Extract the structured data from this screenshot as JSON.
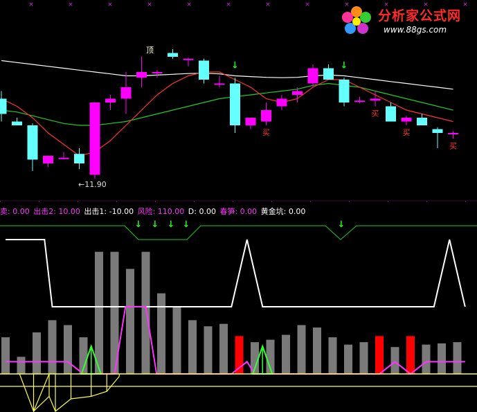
{
  "logo": {
    "title": "分析家公式网",
    "url": "www.88gs.com"
  },
  "colors": {
    "background": "#000000",
    "candle_up": "#ff00ff",
    "candle_down": "#66ffff",
    "ma_short": "#ff3333",
    "ma_mid": "#ffffff",
    "ma_long": "#22cc22",
    "arrow": "#22ee22",
    "buy_label": "#ff3333",
    "bar_gray": "#7a7a7a",
    "bar_red": "#ff0000",
    "white_line": "#ffffff",
    "magenta_line": "#ff33ff",
    "green_line": "#33ff33",
    "yellow_line": "#ffff44",
    "star_marker": "#cc33cc"
  },
  "indicator_labels": [
    {
      "text": "卖: 0.00",
      "color": "#ff33ff"
    },
    {
      "text": "出击2: 10.00",
      "color": "#ff33ff"
    },
    {
      "text": "出击1: -10.00",
      "color": "#ffffff"
    },
    {
      "text": "风险: 110.00",
      "color": "#ff33ff"
    },
    {
      "text": "D: 0.00",
      "color": "#ffffff"
    },
    {
      "text": "春笋: 0.00",
      "color": "#ff33ff"
    },
    {
      "text": "黄金坑: 0.00",
      "color": "#ffffff"
    }
  ],
  "annotations": {
    "top_label": "顶",
    "low_label": "←11.90",
    "buy_label": "买"
  },
  "chart_data": [
    {
      "type": "candlestick",
      "title": "",
      "ylim": [
        11.5,
        15.5
      ],
      "candles": [
        {
          "o": 14.0,
          "h": 14.2,
          "l": 13.4,
          "c": 13.6
        },
        {
          "o": 13.4,
          "h": 13.5,
          "l": 13.3,
          "c": 13.3
        },
        {
          "o": 13.3,
          "h": 13.35,
          "l": 12.1,
          "c": 12.4
        },
        {
          "o": 12.3,
          "h": 12.5,
          "l": 12.2,
          "c": 12.5
        },
        {
          "o": 12.45,
          "h": 12.6,
          "l": 12.4,
          "c": 12.45
        },
        {
          "o": 12.55,
          "h": 12.7,
          "l": 12.15,
          "c": 12.3
        },
        {
          "o": 12.0,
          "h": 13.9,
          "l": 11.9,
          "c": 13.9
        },
        {
          "o": 13.9,
          "h": 14.1,
          "l": 13.7,
          "c": 14.0
        },
        {
          "o": 14.0,
          "h": 14.7,
          "l": 13.6,
          "c": 14.3
        },
        {
          "o": 14.55,
          "h": 15.1,
          "l": 14.3,
          "c": 14.7
        },
        {
          "o": 14.7,
          "h": 14.75,
          "l": 14.55,
          "c": 14.7
        },
        {
          "o": 15.2,
          "h": 15.3,
          "l": 15.05,
          "c": 15.1
        },
        {
          "o": 15.05,
          "h": 15.08,
          "l": 14.85,
          "c": 15.05
        },
        {
          "o": 15.0,
          "h": 15.05,
          "l": 14.4,
          "c": 14.5
        },
        {
          "o": 14.4,
          "h": 14.6,
          "l": 14.3,
          "c": 14.4
        },
        {
          "o": 14.4,
          "h": 14.55,
          "l": 13.1,
          "c": 13.3
        },
        {
          "o": 13.3,
          "h": 13.5,
          "l": 13.2,
          "c": 13.5
        },
        {
          "o": 13.4,
          "h": 13.9,
          "l": 13.3,
          "c": 13.7
        },
        {
          "o": 13.8,
          "h": 14.1,
          "l": 13.7,
          "c": 14.0
        },
        {
          "o": 14.1,
          "h": 14.3,
          "l": 13.9,
          "c": 14.2
        },
        {
          "o": 14.4,
          "h": 14.9,
          "l": 14.3,
          "c": 14.8
        },
        {
          "o": 14.8,
          "h": 14.9,
          "l": 14.5,
          "c": 14.5
        },
        {
          "o": 14.5,
          "h": 14.55,
          "l": 13.8,
          "c": 13.9
        },
        {
          "o": 13.95,
          "h": 14.05,
          "l": 13.88,
          "c": 13.95
        },
        {
          "o": 13.95,
          "h": 14.2,
          "l": 13.8,
          "c": 14.0
        },
        {
          "o": 13.8,
          "h": 13.9,
          "l": 13.4,
          "c": 13.4
        },
        {
          "o": 13.4,
          "h": 13.55,
          "l": 13.3,
          "c": 13.5
        },
        {
          "o": 13.5,
          "h": 13.6,
          "l": 13.3,
          "c": 13.3
        },
        {
          "o": 13.2,
          "h": 13.25,
          "l": 12.7,
          "c": 13.1
        },
        {
          "o": 13.1,
          "h": 13.15,
          "l": 12.95,
          "c": 13.1
        }
      ],
      "ma_short": [
        14.0,
        13.8,
        13.5,
        13.1,
        12.8,
        12.5,
        12.6,
        12.9,
        13.3,
        13.7,
        14.1,
        14.4,
        14.6,
        14.7,
        14.7,
        14.5,
        14.3,
        14.0,
        13.9,
        14.0,
        14.3,
        14.5,
        14.5,
        14.3,
        14.1,
        13.9,
        13.7,
        13.6,
        13.5,
        13.4
      ],
      "ma_mid": [
        15.0,
        14.95,
        14.9,
        14.85,
        14.8,
        14.75,
        14.7,
        14.65,
        14.6,
        14.6,
        14.62,
        14.64,
        14.66,
        14.67,
        14.65,
        14.6,
        14.58,
        14.56,
        14.55,
        14.56,
        14.6,
        14.62,
        14.6,
        14.55,
        14.5,
        14.45,
        14.4,
        14.35,
        14.3,
        14.25
      ],
      "ma_long": [
        13.7,
        13.65,
        13.55,
        13.45,
        13.35,
        13.3,
        13.3,
        13.35,
        13.4,
        13.5,
        13.6,
        13.7,
        13.8,
        13.9,
        14.0,
        14.05,
        14.1,
        14.15,
        14.2,
        14.25,
        14.35,
        14.4,
        14.35,
        14.3,
        14.2,
        14.1,
        14.0,
        13.9,
        13.8,
        13.7
      ],
      "arrows": [
        15,
        22
      ],
      "buy_marks": [
        17,
        24,
        26,
        29
      ],
      "top_mark": 9,
      "low_mark": 6
    },
    {
      "type": "bar",
      "title": "",
      "ylim": [
        0,
        110
      ],
      "bars": [
        {
          "v": 30,
          "c": "gray"
        },
        {
          "v": 14,
          "c": "gray"
        },
        {
          "v": 34,
          "c": "gray"
        },
        {
          "v": 44,
          "c": "gray"
        },
        {
          "v": 40,
          "c": "gray"
        },
        {
          "v": 30,
          "c": "gray"
        },
        {
          "v": 100,
          "c": "gray"
        },
        {
          "v": 100,
          "c": "gray"
        },
        {
          "v": 86,
          "c": "gray"
        },
        {
          "v": 100,
          "c": "gray"
        },
        {
          "v": 66,
          "c": "gray"
        },
        {
          "v": 55,
          "c": "gray"
        },
        {
          "v": 44,
          "c": "gray"
        },
        {
          "v": 39,
          "c": "gray"
        },
        {
          "v": 41,
          "c": "gray"
        },
        {
          "v": 31,
          "c": "red"
        },
        {
          "v": 26,
          "c": "gray"
        },
        {
          "v": 28,
          "c": "gray"
        },
        {
          "v": 32,
          "c": "gray"
        },
        {
          "v": 40,
          "c": "gray"
        },
        {
          "v": 38,
          "c": "gray"
        },
        {
          "v": 30,
          "c": "gray"
        },
        {
          "v": 24,
          "c": "gray"
        },
        {
          "v": 26,
          "c": "gray"
        },
        {
          "v": 31,
          "c": "red"
        },
        {
          "v": 22,
          "c": "gray"
        },
        {
          "v": 31,
          "c": "red"
        },
        {
          "v": 24,
          "c": "gray"
        },
        {
          "v": 25,
          "c": "gray"
        },
        {
          "v": 26,
          "c": "gray"
        }
      ],
      "white_line": [
        [
          0,
          110
        ],
        [
          0.8,
          110
        ],
        [
          1.5,
          110
        ],
        [
          2.5,
          110
        ],
        [
          3,
          55
        ],
        [
          6,
          55
        ],
        [
          9,
          55
        ],
        [
          13,
          55
        ],
        [
          14.5,
          55
        ],
        [
          15.5,
          110
        ],
        [
          16.5,
          55
        ],
        [
          20,
          55
        ],
        [
          27.5,
          55
        ],
        [
          28.5,
          110
        ],
        [
          29.5,
          55
        ]
      ],
      "magenta_line": [
        [
          0,
          10
        ],
        [
          4,
          10
        ],
        [
          5,
          0
        ],
        [
          6,
          0
        ],
        [
          7,
          0
        ],
        [
          7.7,
          55
        ],
        [
          9,
          55
        ],
        [
          9.7,
          0
        ],
        [
          14.5,
          0
        ],
        [
          15.5,
          10
        ],
        [
          16,
          0
        ],
        [
          24,
          0
        ],
        [
          25,
          10
        ],
        [
          26,
          0
        ],
        [
          27,
          10
        ],
        [
          29.5,
          10
        ]
      ],
      "green_triangles": [
        5.5,
        16.5
      ],
      "yellow_lines": [
        [
          0,
          0
        ],
        [
          29.8,
          0
        ]
      ],
      "yellow_below": [
        [
          1.8,
          -30
        ],
        [
          2.8,
          -18
        ],
        [
          3.2,
          -30
        ],
        [
          4.2,
          -20
        ],
        [
          5.5,
          -18
        ],
        [
          6.5,
          -14
        ],
        [
          7.3,
          -2
        ]
      ]
    }
  ]
}
